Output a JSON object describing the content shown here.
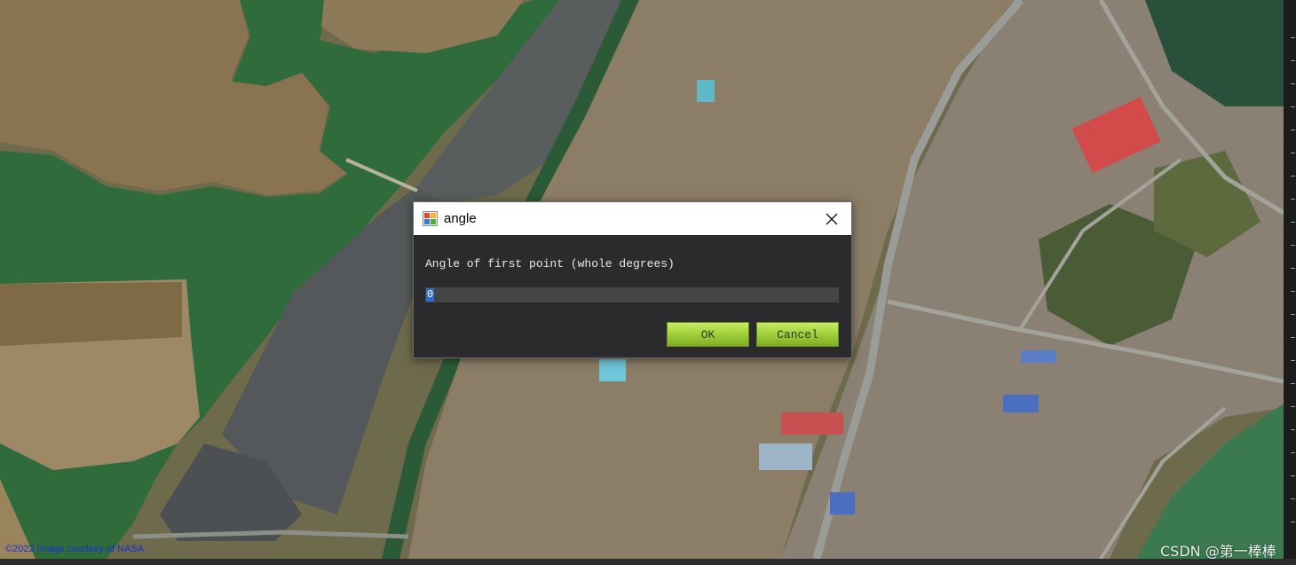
{
  "map": {
    "credit": "©2022 Image courtesy of NASA",
    "watermark": "CSDN @第一棒棒"
  },
  "dialog": {
    "title": "angle",
    "prompt": "Angle of first point (whole degrees)",
    "input_value": "0",
    "ok_label": "OK",
    "cancel_label": "Cancel",
    "icons": {
      "app": "app-icon",
      "close": "close-icon"
    }
  },
  "colors": {
    "button_green": "#a2d23c",
    "dialog_body": "#2b2b2d",
    "input_bg": "#454548",
    "selection": "#2a6fd0"
  }
}
